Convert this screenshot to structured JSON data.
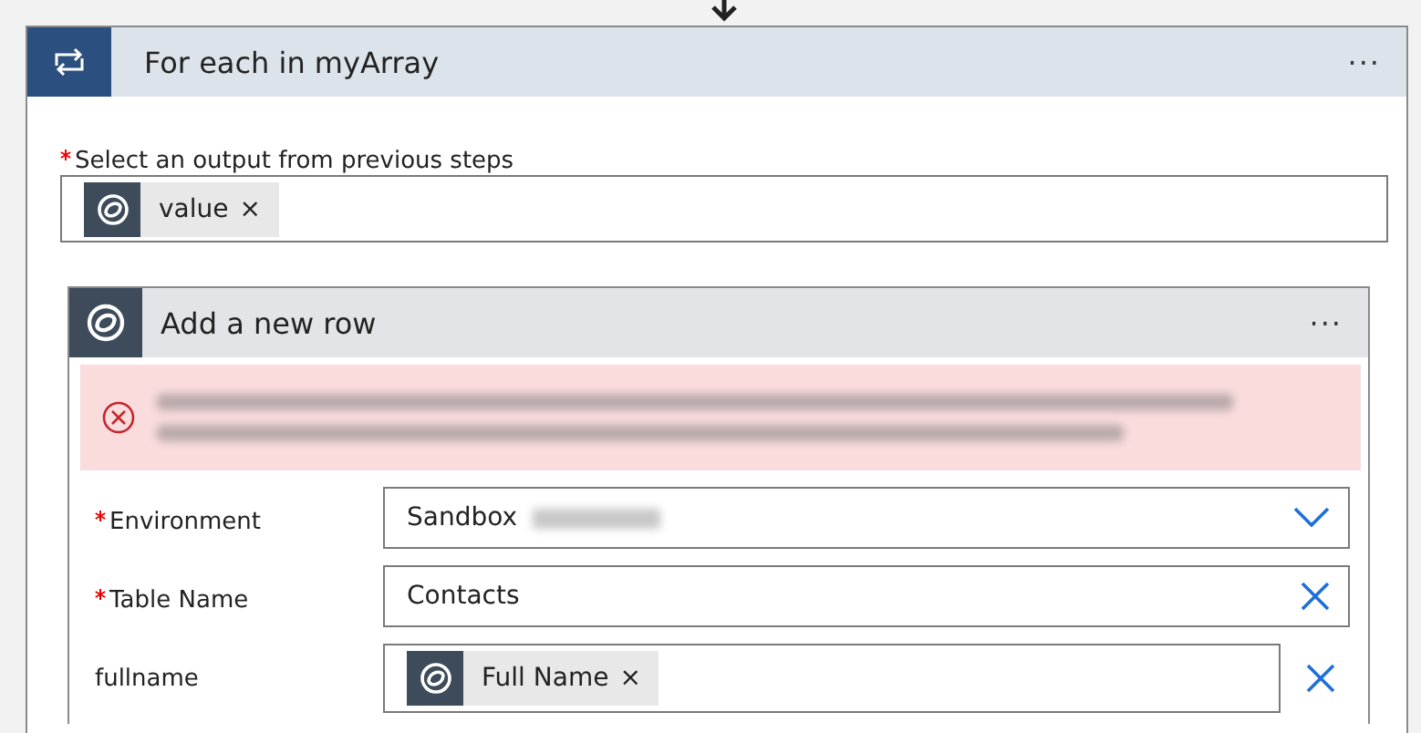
{
  "loop": {
    "title": "For each in myArray",
    "menu": "···",
    "output_field": {
      "label": "Select an output from previous steps",
      "required": true,
      "token": "value",
      "token_remove": "×"
    }
  },
  "action": {
    "title": "Add a new row",
    "menu": "···",
    "fields": [
      {
        "kind": "dropdown",
        "label": "Environment",
        "required": true,
        "value": "Sandbox"
      },
      {
        "kind": "clearable",
        "label": "Table Name",
        "required": true,
        "value": "Contacts"
      },
      {
        "kind": "token",
        "label": "fullname",
        "required": false,
        "value": "Full Name",
        "token_remove": "×"
      }
    ]
  }
}
